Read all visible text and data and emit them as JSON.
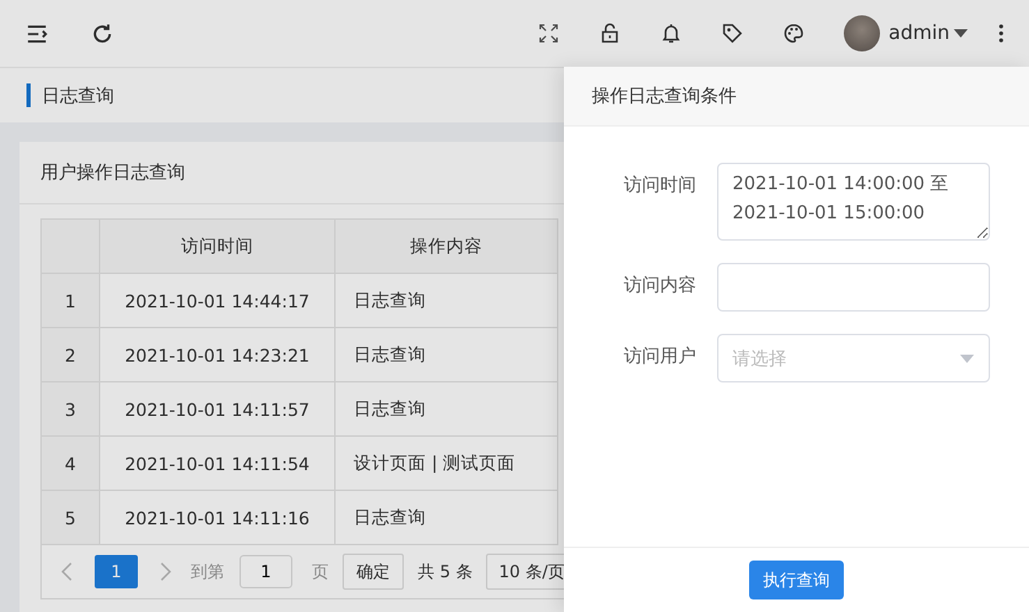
{
  "header": {
    "user": "admin"
  },
  "breadcrumb": {
    "title": "日志查询"
  },
  "card": {
    "title": "用户操作日志查询",
    "table": {
      "columns": [
        "",
        "访问时间",
        "操作内容"
      ],
      "rows": [
        {
          "cells": [
            "1",
            "2021-10-01 14:44:17",
            "日志查询"
          ]
        },
        {
          "cells": [
            "2",
            "2021-10-01 14:23:21",
            "日志查询"
          ]
        },
        {
          "cells": [
            "3",
            "2021-10-01 14:11:57",
            "日志查询"
          ]
        },
        {
          "cells": [
            "4",
            "2021-10-01 14:11:54",
            "设计页面 | 测试页面"
          ]
        },
        {
          "cells": [
            "5",
            "2021-10-01 14:11:16",
            "日志查询"
          ]
        }
      ]
    },
    "pagination": {
      "pages": [
        {
          "label": "1",
          "selected": true
        }
      ],
      "goto_label": "到第",
      "goto_value": "1",
      "page_label": "页",
      "confirm": "确定",
      "total": "共 5 条",
      "page_size": "10 条/页"
    }
  },
  "drawer": {
    "title": "操作日志查询条件",
    "fields": [
      {
        "kind": "textarea",
        "label": "访问时间",
        "value": "2021-10-01 14:00:00 至 2021-10-01 15:00:00"
      },
      {
        "kind": "input",
        "label": "访问内容"
      },
      {
        "kind": "select",
        "label": "访问用户",
        "placeholder": "请选择"
      }
    ],
    "submit": "执行查询"
  }
}
